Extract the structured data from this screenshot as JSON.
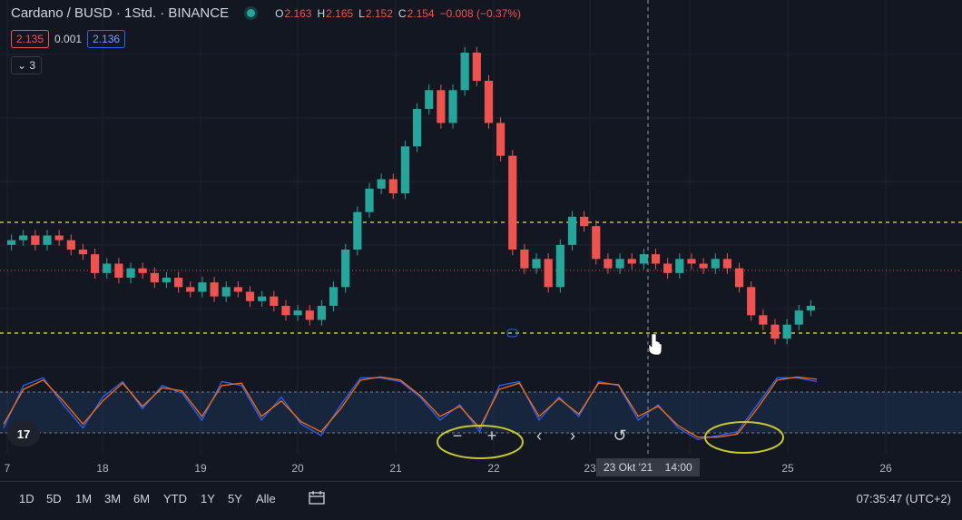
{
  "header": {
    "symbol": "Cardano / BUSD · 1Std. · BINANCE",
    "ohlc": {
      "o_label": "O",
      "o": "2.163",
      "h_label": "H",
      "h": "2.165",
      "l_label": "L",
      "l": "2.152",
      "c_label": "C",
      "c": "2.154",
      "change": "−0.008 (−0.37%)"
    }
  },
  "prices": {
    "bid": "2.135",
    "spread": "0.001",
    "ask": "2.136"
  },
  "collapse_label": "3",
  "logo_text": "17",
  "nav_icons": [
    "minus-icon",
    "plus-icon",
    "chevron-left-icon",
    "chevron-right-icon",
    "reset-icon"
  ],
  "x_axis": {
    "ticks": [
      "7",
      "18",
      "19",
      "20",
      "21",
      "22",
      "23",
      "25",
      "26"
    ],
    "crosshair_label": "23 Okt '21    14:00"
  },
  "bottom_bar": {
    "ranges": [
      "1D",
      "5D",
      "1M",
      "3M",
      "6M",
      "YTD",
      "1Y",
      "5Y",
      "Alle"
    ],
    "clock": "07:35:47 (UTC+2)"
  },
  "colors": {
    "background": "#131722",
    "up": "#26a69a",
    "down": "#ef5350",
    "stoch_k": "#2962ff",
    "stoch_d": "#ff6d00",
    "level_lines": "#e7e73a",
    "highlight_circles": "#c8c82a"
  },
  "chart_data": {
    "type": "candlestick",
    "horizontal_levels": [
      "upper-dashed",
      "lower-dashed"
    ],
    "candle_closes": [
      2.3,
      2.31,
      2.29,
      2.31,
      2.3,
      2.28,
      2.27,
      2.23,
      2.25,
      2.22,
      2.24,
      2.23,
      2.21,
      2.22,
      2.2,
      2.19,
      2.21,
      2.18,
      2.2,
      2.19,
      2.17,
      2.18,
      2.16,
      2.14,
      2.15,
      2.13,
      2.16,
      2.2,
      2.28,
      2.36,
      2.41,
      2.43,
      2.4,
      2.5,
      2.58,
      2.62,
      2.55,
      2.62,
      2.7,
      2.64,
      2.55,
      2.48,
      2.28,
      2.24,
      2.26,
      2.2,
      2.29,
      2.35,
      2.33,
      2.26,
      2.24,
      2.26,
      2.25,
      2.27,
      2.25,
      2.23,
      2.26,
      2.25,
      2.24,
      2.26,
      2.24,
      2.2,
      2.14,
      2.12,
      2.09,
      2.12,
      2.15,
      2.16
    ],
    "stochastic": {
      "k": [
        30,
        85,
        95,
        60,
        30,
        70,
        90,
        55,
        85,
        75,
        40,
        90,
        85,
        40,
        70,
        35,
        20,
        60,
        95,
        95,
        90,
        70,
        40,
        60,
        25,
        85,
        90,
        40,
        70,
        45,
        90,
        85,
        40,
        60,
        30,
        15,
        20,
        25,
        60,
        95,
        95,
        90
      ],
      "d": [
        35,
        80,
        92,
        65,
        35,
        65,
        88,
        58,
        82,
        78,
        45,
        85,
        88,
        45,
        65,
        38,
        25,
        55,
        92,
        96,
        92,
        72,
        45,
        58,
        30,
        80,
        88,
        45,
        68,
        48,
        88,
        86,
        45,
        58,
        33,
        18,
        18,
        22,
        55,
        92,
        96,
        93
      ],
      "upper_band": 80,
      "lower_band": 20
    }
  }
}
